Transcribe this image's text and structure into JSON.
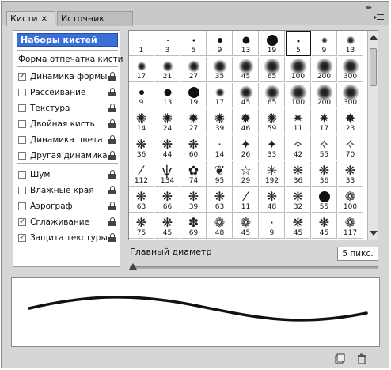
{
  "tabs": [
    {
      "label": "Кисти",
      "close": "✕",
      "active": true
    },
    {
      "label": "Источник клонов",
      "active": false
    }
  ],
  "left_panel": {
    "presets_button": "Наборы кистей",
    "section_header": "Форма отпечатка кисти",
    "options": [
      {
        "label": "Динамика формы",
        "checked": true,
        "lock": true
      },
      {
        "label": "Рассеивание",
        "checked": false,
        "lock": true
      },
      {
        "label": "Текстура",
        "checked": false,
        "lock": true
      },
      {
        "label": "Двойная кисть",
        "checked": false,
        "lock": true
      },
      {
        "label": "Динамика цвета",
        "checked": false,
        "lock": true
      },
      {
        "label": "Другая динамика",
        "checked": false,
        "lock": true
      },
      {
        "label": "Шум",
        "checked": false,
        "lock": true
      },
      {
        "label": "Влажные края",
        "checked": false,
        "lock": true
      },
      {
        "label": "Аэрограф",
        "checked": false,
        "lock": true
      },
      {
        "label": "Сглаживание",
        "checked": true,
        "lock": true
      },
      {
        "label": "Защита текстуры",
        "checked": true,
        "lock": true
      }
    ]
  },
  "brushes": [
    {
      "n": "1",
      "kind": "hard",
      "s": 1
    },
    {
      "n": "3",
      "kind": "hard",
      "s": 2
    },
    {
      "n": "5",
      "kind": "hard",
      "s": 3
    },
    {
      "n": "9",
      "kind": "hard",
      "s": 6
    },
    {
      "n": "13",
      "kind": "hard",
      "s": 9
    },
    {
      "n": "19",
      "kind": "hard",
      "s": 14
    },
    {
      "n": "5",
      "kind": "hard",
      "s": 3,
      "selected": true
    },
    {
      "n": "9",
      "kind": "soft",
      "s": 8
    },
    {
      "n": "13",
      "kind": "soft",
      "s": 11
    },
    {
      "n": "17",
      "kind": "soft",
      "s": 12
    },
    {
      "n": "21",
      "kind": "soft",
      "s": 14
    },
    {
      "n": "27",
      "kind": "soft",
      "s": 16
    },
    {
      "n": "35",
      "kind": "soft",
      "s": 18
    },
    {
      "n": "45",
      "kind": "soft",
      "s": 20
    },
    {
      "n": "65",
      "kind": "soft",
      "s": 22
    },
    {
      "n": "100",
      "kind": "soft",
      "s": 22
    },
    {
      "n": "200",
      "kind": "soft",
      "s": 22
    },
    {
      "n": "300",
      "kind": "soft",
      "s": 22
    },
    {
      "n": "9",
      "kind": "hard",
      "s": 6
    },
    {
      "n": "13",
      "kind": "hard",
      "s": 9
    },
    {
      "n": "19",
      "kind": "hard",
      "s": 14
    },
    {
      "n": "17",
      "kind": "soft",
      "s": 12
    },
    {
      "n": "45",
      "kind": "soft",
      "s": 18
    },
    {
      "n": "65",
      "kind": "soft",
      "s": 20
    },
    {
      "n": "100",
      "kind": "soft",
      "s": 22
    },
    {
      "n": "200",
      "kind": "soft",
      "s": 22
    },
    {
      "n": "300",
      "kind": "soft",
      "s": 22
    },
    {
      "n": "14",
      "kind": "glyph",
      "g": "✺"
    },
    {
      "n": "24",
      "kind": "glyph",
      "g": "✺"
    },
    {
      "n": "27",
      "kind": "glyph",
      "g": "✹"
    },
    {
      "n": "39",
      "kind": "glyph",
      "g": "✺"
    },
    {
      "n": "46",
      "kind": "glyph",
      "g": "✹"
    },
    {
      "n": "59",
      "kind": "glyph",
      "g": "✺"
    },
    {
      "n": "11",
      "kind": "glyph",
      "g": "✷"
    },
    {
      "n": "17",
      "kind": "glyph",
      "g": "✷"
    },
    {
      "n": "23",
      "kind": "glyph",
      "g": "✸"
    },
    {
      "n": "36",
      "kind": "glyph",
      "g": "❋"
    },
    {
      "n": "44",
      "kind": "glyph",
      "g": "❋"
    },
    {
      "n": "60",
      "kind": "glyph",
      "g": "❋"
    },
    {
      "n": "14",
      "kind": "glyph",
      "g": "·"
    },
    {
      "n": "26",
      "kind": "glyph",
      "g": "✦"
    },
    {
      "n": "33",
      "kind": "glyph",
      "g": "✦"
    },
    {
      "n": "42",
      "kind": "glyph",
      "g": "✧"
    },
    {
      "n": "55",
      "kind": "glyph",
      "g": "✧"
    },
    {
      "n": "70",
      "kind": "glyph",
      "g": "✧"
    },
    {
      "n": "112",
      "kind": "glyph",
      "g": "⁄"
    },
    {
      "n": "134",
      "kind": "glyph",
      "g": "ѱ"
    },
    {
      "n": "74",
      "kind": "glyph",
      "g": "✿"
    },
    {
      "n": "95",
      "kind": "glyph",
      "g": "❦"
    },
    {
      "n": "29",
      "kind": "glyph",
      "g": "☆"
    },
    {
      "n": "192",
      "kind": "glyph",
      "g": "✳"
    },
    {
      "n": "36",
      "kind": "glyph",
      "g": "❋"
    },
    {
      "n": "36",
      "kind": "glyph",
      "g": "❋"
    },
    {
      "n": "33",
      "kind": "glyph",
      "g": "❋"
    },
    {
      "n": "63",
      "kind": "glyph",
      "g": "❋"
    },
    {
      "n": "66",
      "kind": "glyph",
      "g": "❋"
    },
    {
      "n": "39",
      "kind": "glyph",
      "g": "❋"
    },
    {
      "n": "63",
      "kind": "glyph",
      "g": "❋"
    },
    {
      "n": "11",
      "kind": "glyph",
      "g": "⁄"
    },
    {
      "n": "48",
      "kind": "glyph",
      "g": "❋"
    },
    {
      "n": "32",
      "kind": "glyph",
      "g": "❋"
    },
    {
      "n": "55",
      "kind": "hard",
      "s": 14
    },
    {
      "n": "100",
      "kind": "glyph",
      "g": "❁"
    },
    {
      "n": "75",
      "kind": "glyph",
      "g": "❋"
    },
    {
      "n": "45",
      "kind": "glyph",
      "g": "❋"
    },
    {
      "n": "69",
      "kind": "glyph",
      "g": "✽"
    },
    {
      "n": "48",
      "kind": "glyph",
      "g": "❁"
    },
    {
      "n": "45",
      "kind": "glyph",
      "g": "❁"
    },
    {
      "n": "9",
      "kind": "glyph",
      "g": "·"
    },
    {
      "n": "45",
      "kind": "glyph",
      "g": "❋"
    },
    {
      "n": "45",
      "kind": "glyph",
      "g": "❋"
    },
    {
      "n": "117",
      "kind": "glyph",
      "g": "❁"
    }
  ],
  "diameter": {
    "label": "Главный диаметр",
    "value": "5 пикс."
  }
}
